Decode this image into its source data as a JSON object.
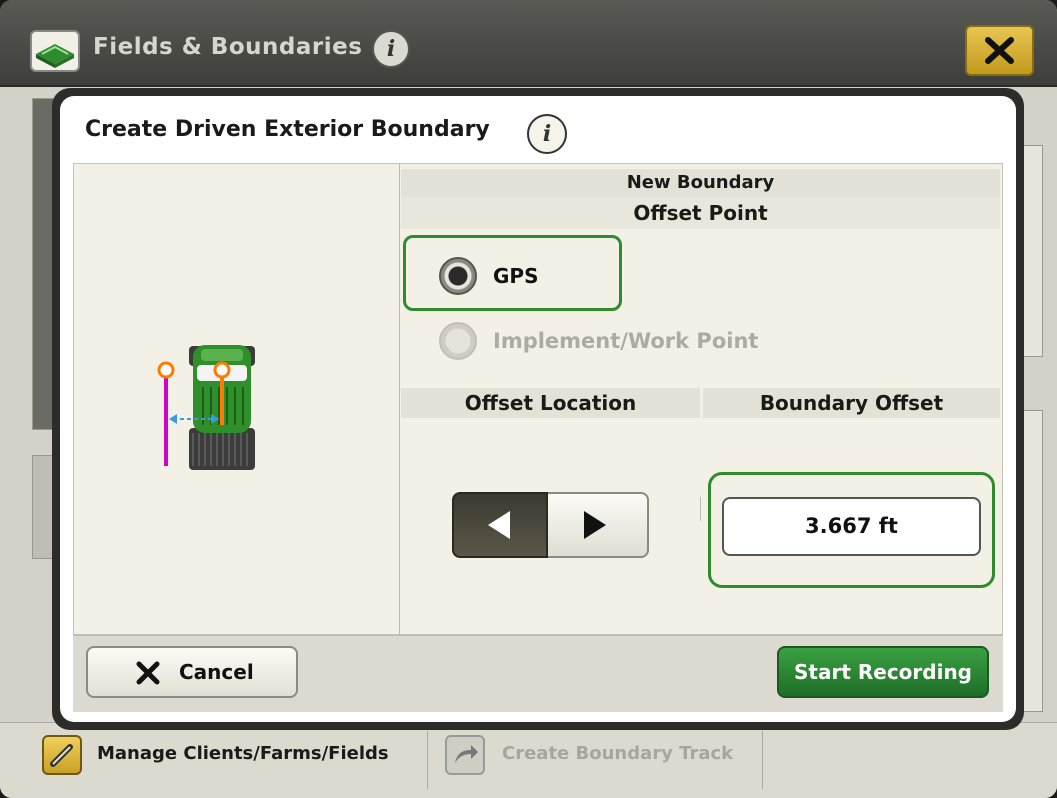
{
  "app": {
    "title": "Fields & Boundaries",
    "info_icon": "info-icon",
    "close_icon": "close-icon"
  },
  "bottom_bar": {
    "manage_label": "Manage Clients/Farms/Fields",
    "create_track_label": "Create Boundary Track"
  },
  "dialog": {
    "title": "Create Driven Exterior Boundary",
    "section_header_1": "New Boundary",
    "section_header_2": "Offset Point",
    "radio_options": [
      {
        "label": "GPS",
        "selected": true,
        "enabled": true
      },
      {
        "label": "Implement/Work Point",
        "selected": false,
        "enabled": false
      }
    ],
    "offset_location_header": "Offset Location",
    "boundary_offset_header": "Boundary Offset",
    "offset_location_selected": "left",
    "boundary_offset_value": "3.667 ft",
    "cancel_label": "Cancel",
    "start_label": "Start Recording"
  },
  "colors": {
    "accent_green": "#2e8b2e",
    "button_green": "#2a8a33",
    "close_yellow": "#d9b233",
    "boundary_line_magenta": "#d400c8",
    "offset_marker_orange": "#ff7a00",
    "offset_arrow_blue": "#3a9be0"
  }
}
